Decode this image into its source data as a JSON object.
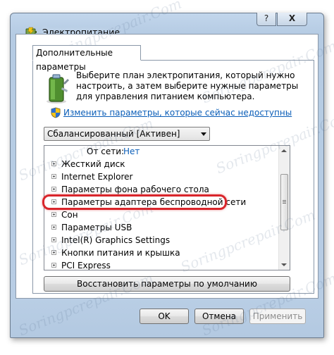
{
  "window": {
    "title": "Электропитание",
    "help_label": "?",
    "close_label": "X"
  },
  "tab": {
    "label": "Дополнительные параметры"
  },
  "description": "Выберите план электропитания, который нужно настроить, а затем выберите нужные параметры для управления питанием компьютера.",
  "change_link": "Изменить параметры, которые сейчас недоступны",
  "plan_select": {
    "value": "Сбалансированный [Активен]"
  },
  "tree": {
    "sub_setting": {
      "label": "От сети:",
      "value": "Нет"
    },
    "items": [
      "Жесткий диск",
      "Internet Explorer",
      "Параметры фона рабочего стола",
      "Параметры адаптера беспроводной сети",
      "Сон",
      "Параметры USB",
      "Intel(R) Graphics Settings",
      "Кнопки питания и крышка",
      "PCI Express"
    ],
    "highlighted_index": 3
  },
  "buttons": {
    "restore": "Восстановить параметры по умолчанию",
    "ok": "OK",
    "cancel": "Отмена",
    "apply": "Применить"
  },
  "watermark": "Soringpcrepair.Com",
  "colors": {
    "link": "#0b5eb8",
    "highlight": "#d9252b",
    "frame": "#b8cde4"
  }
}
